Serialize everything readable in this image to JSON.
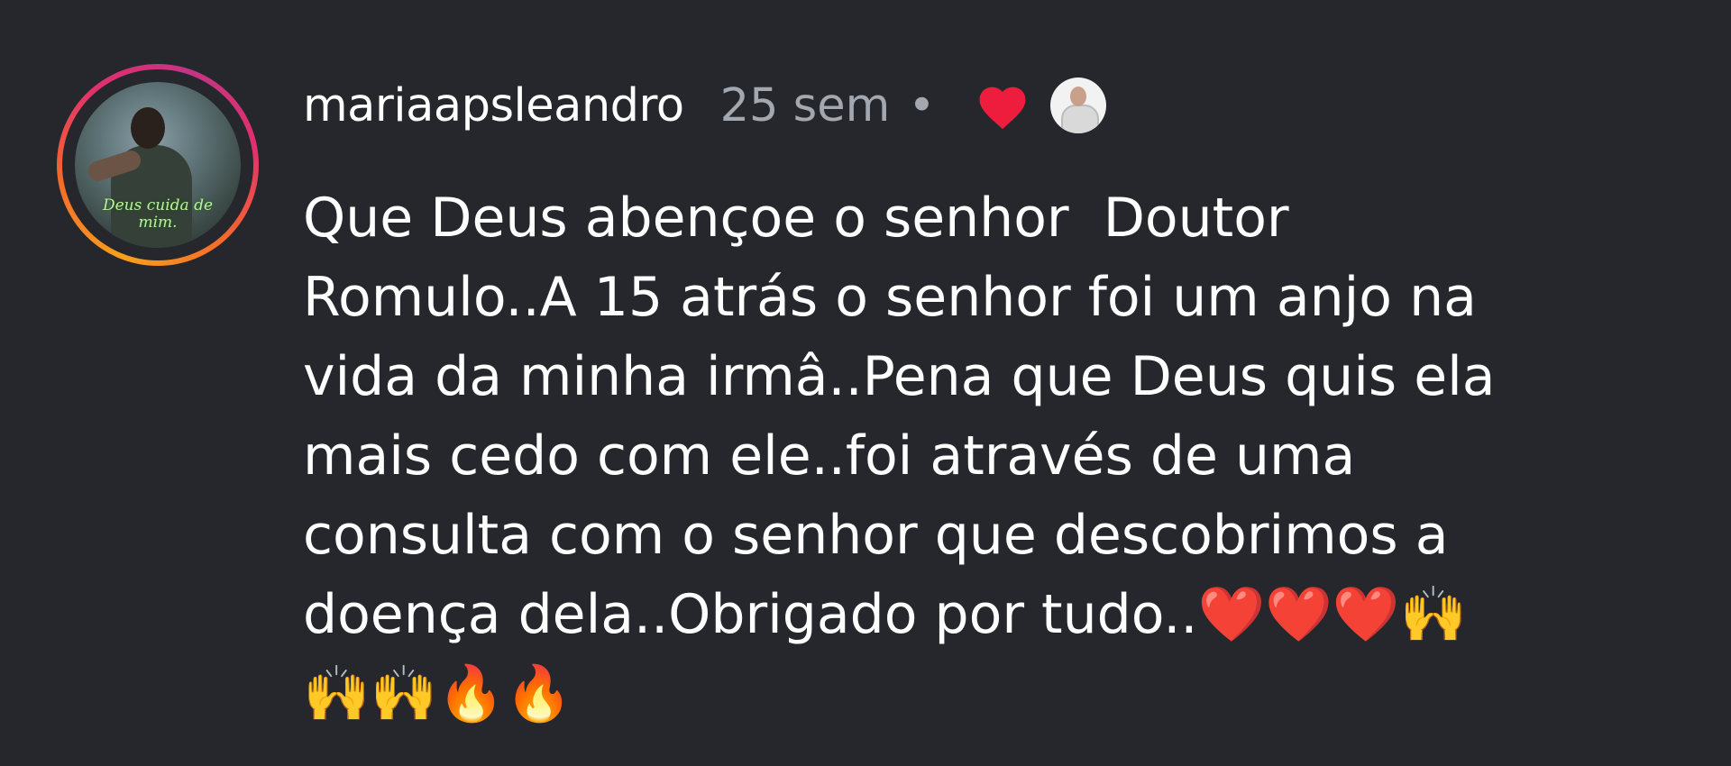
{
  "comment": {
    "username": "mariaapsleandro",
    "time": "25 sem",
    "separator": "•",
    "avatar_caption": "Deus cuida de mim.",
    "text": "Que Deus abençoe o senhor  Doutor\nRomulo..A 15 atrás o senhor foi um anjo na\nvida da minha irmâ..Pena que Deus quis ela\nmais cedo com ele..foi através de uma\nconsulta com o senhor que descobrimos a\ndoença dela..Obrigado por tudo..❤️❤️❤️🙌\n🙌🙌🔥🔥",
    "icons": {
      "like": "heart-icon",
      "liker": "liker-avatar"
    }
  },
  "colors": {
    "background": "#25272c",
    "text": "#ffffff",
    "muted": "#a3a8b0",
    "heart": "#ee1d3d"
  }
}
